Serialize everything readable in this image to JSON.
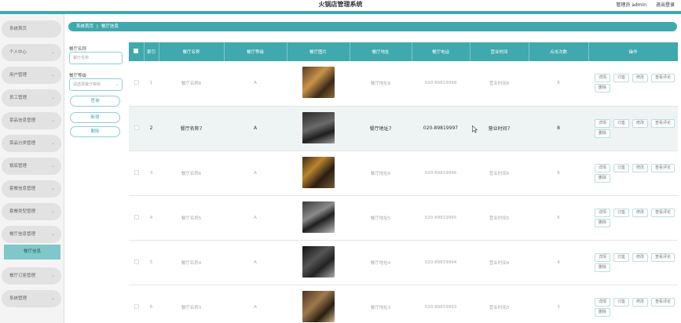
{
  "header": {
    "app_title": "火锅店管理系统",
    "user_label": "管理员 admin",
    "logout_label": "退出登录"
  },
  "breadcrumb": {
    "home": "系统首页",
    "sep": "|",
    "current": "餐厅信息"
  },
  "sidebar": {
    "items": [
      {
        "label": "系统首页",
        "has_chevron": false
      },
      {
        "label": "个人中心",
        "has_chevron": true
      },
      {
        "label": "用户管理",
        "has_chevron": true
      },
      {
        "label": "员工管理",
        "has_chevron": true
      },
      {
        "label": "菜品信息管理",
        "has_chevron": true
      },
      {
        "label": "菜品分类管理",
        "has_chevron": true
      },
      {
        "label": "锅底管理",
        "has_chevron": true
      },
      {
        "label": "套餐信息管理",
        "has_chevron": true
      },
      {
        "label": "套餐类型管理",
        "has_chevron": true
      },
      {
        "label": "餐厅信息管理",
        "has_chevron": true
      },
      {
        "label": "餐厅订座管理",
        "has_chevron": true
      },
      {
        "label": "系统管理",
        "has_chevron": true
      }
    ],
    "active_sub": "餐厅信息"
  },
  "search": {
    "name_label": "餐厅名称",
    "name_placeholder": "餐厅名称",
    "grade_label": "餐厅等级",
    "grade_placeholder": "请选择餐厅等级",
    "query_button": "查询",
    "add_button": "新增",
    "delete_button": "删除"
  },
  "table": {
    "headers": [
      "索引",
      "餐厅名称",
      "餐厅等级",
      "餐厅图片",
      "餐厅地址",
      "餐厅电话",
      "营业时间",
      "点击次数",
      "操作"
    ],
    "rows": [
      {
        "index": "1",
        "name": "餐厅名称8",
        "grade": "A",
        "address": "餐厅地址8",
        "phone": "020-89819998",
        "hours": "营业时间8",
        "clicks": "8",
        "highlight": false
      },
      {
        "index": "2",
        "name": "餐厅名称7",
        "grade": "A",
        "address": "餐厅地址7",
        "phone": "020-89819997",
        "hours": "营业时间7",
        "clicks": "8",
        "highlight": true
      },
      {
        "index": "3",
        "name": "餐厅名称6",
        "grade": "A",
        "address": "餐厅地址6",
        "phone": "020-89819996",
        "hours": "营业时间6",
        "clicks": "6",
        "highlight": false
      },
      {
        "index": "4",
        "name": "餐厅名称5",
        "grade": "A",
        "address": "餐厅地址5",
        "phone": "020-89819995",
        "hours": "营业时间5",
        "clicks": "5",
        "highlight": false
      },
      {
        "index": "5",
        "name": "餐厅名称4",
        "grade": "A",
        "address": "餐厅地址4",
        "phone": "020-89819994",
        "hours": "营业时间4",
        "clicks": "4",
        "highlight": false
      },
      {
        "index": "6",
        "name": "餐厅名称3",
        "grade": "A",
        "address": "餐厅地址3",
        "phone": "020-89819993",
        "hours": "营业时间3",
        "clicks": "3",
        "highlight": false
      }
    ],
    "actions": [
      "详情",
      "订座",
      "修改",
      "查看评论",
      "删除"
    ]
  },
  "colors": {
    "accent": "#3fa9ad",
    "accent_light": "#7fc7c9"
  }
}
